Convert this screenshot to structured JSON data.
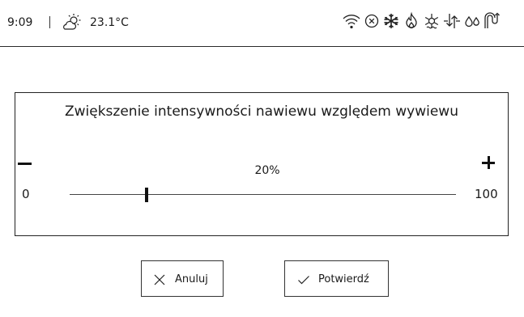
{
  "status_bar": {
    "time": "9:09",
    "temperature": "23.1°C",
    "weather_icon": "partly-cloudy-sun-icon",
    "icons": [
      "wifi-icon",
      "circle-x-icon",
      "snowflake-icon",
      "flame-icon",
      "defrost-icon",
      "airflow-arrows-icon",
      "humidity-drops-icon",
      "hygiene-bracket-icon"
    ]
  },
  "dialog": {
    "title": "Zwiększenie intensywności nawiewu względem wywiewu",
    "value_label": "20%",
    "min_label": "0",
    "max_label": "100",
    "slider_value": 20,
    "slider_min": 0,
    "slider_max": 100
  },
  "buttons": {
    "cancel_label": "Anuluj",
    "confirm_label": "Potwierdź"
  },
  "colors": {
    "background": "#ffffff",
    "foreground": "#1a1a1a",
    "border": "#222222"
  }
}
